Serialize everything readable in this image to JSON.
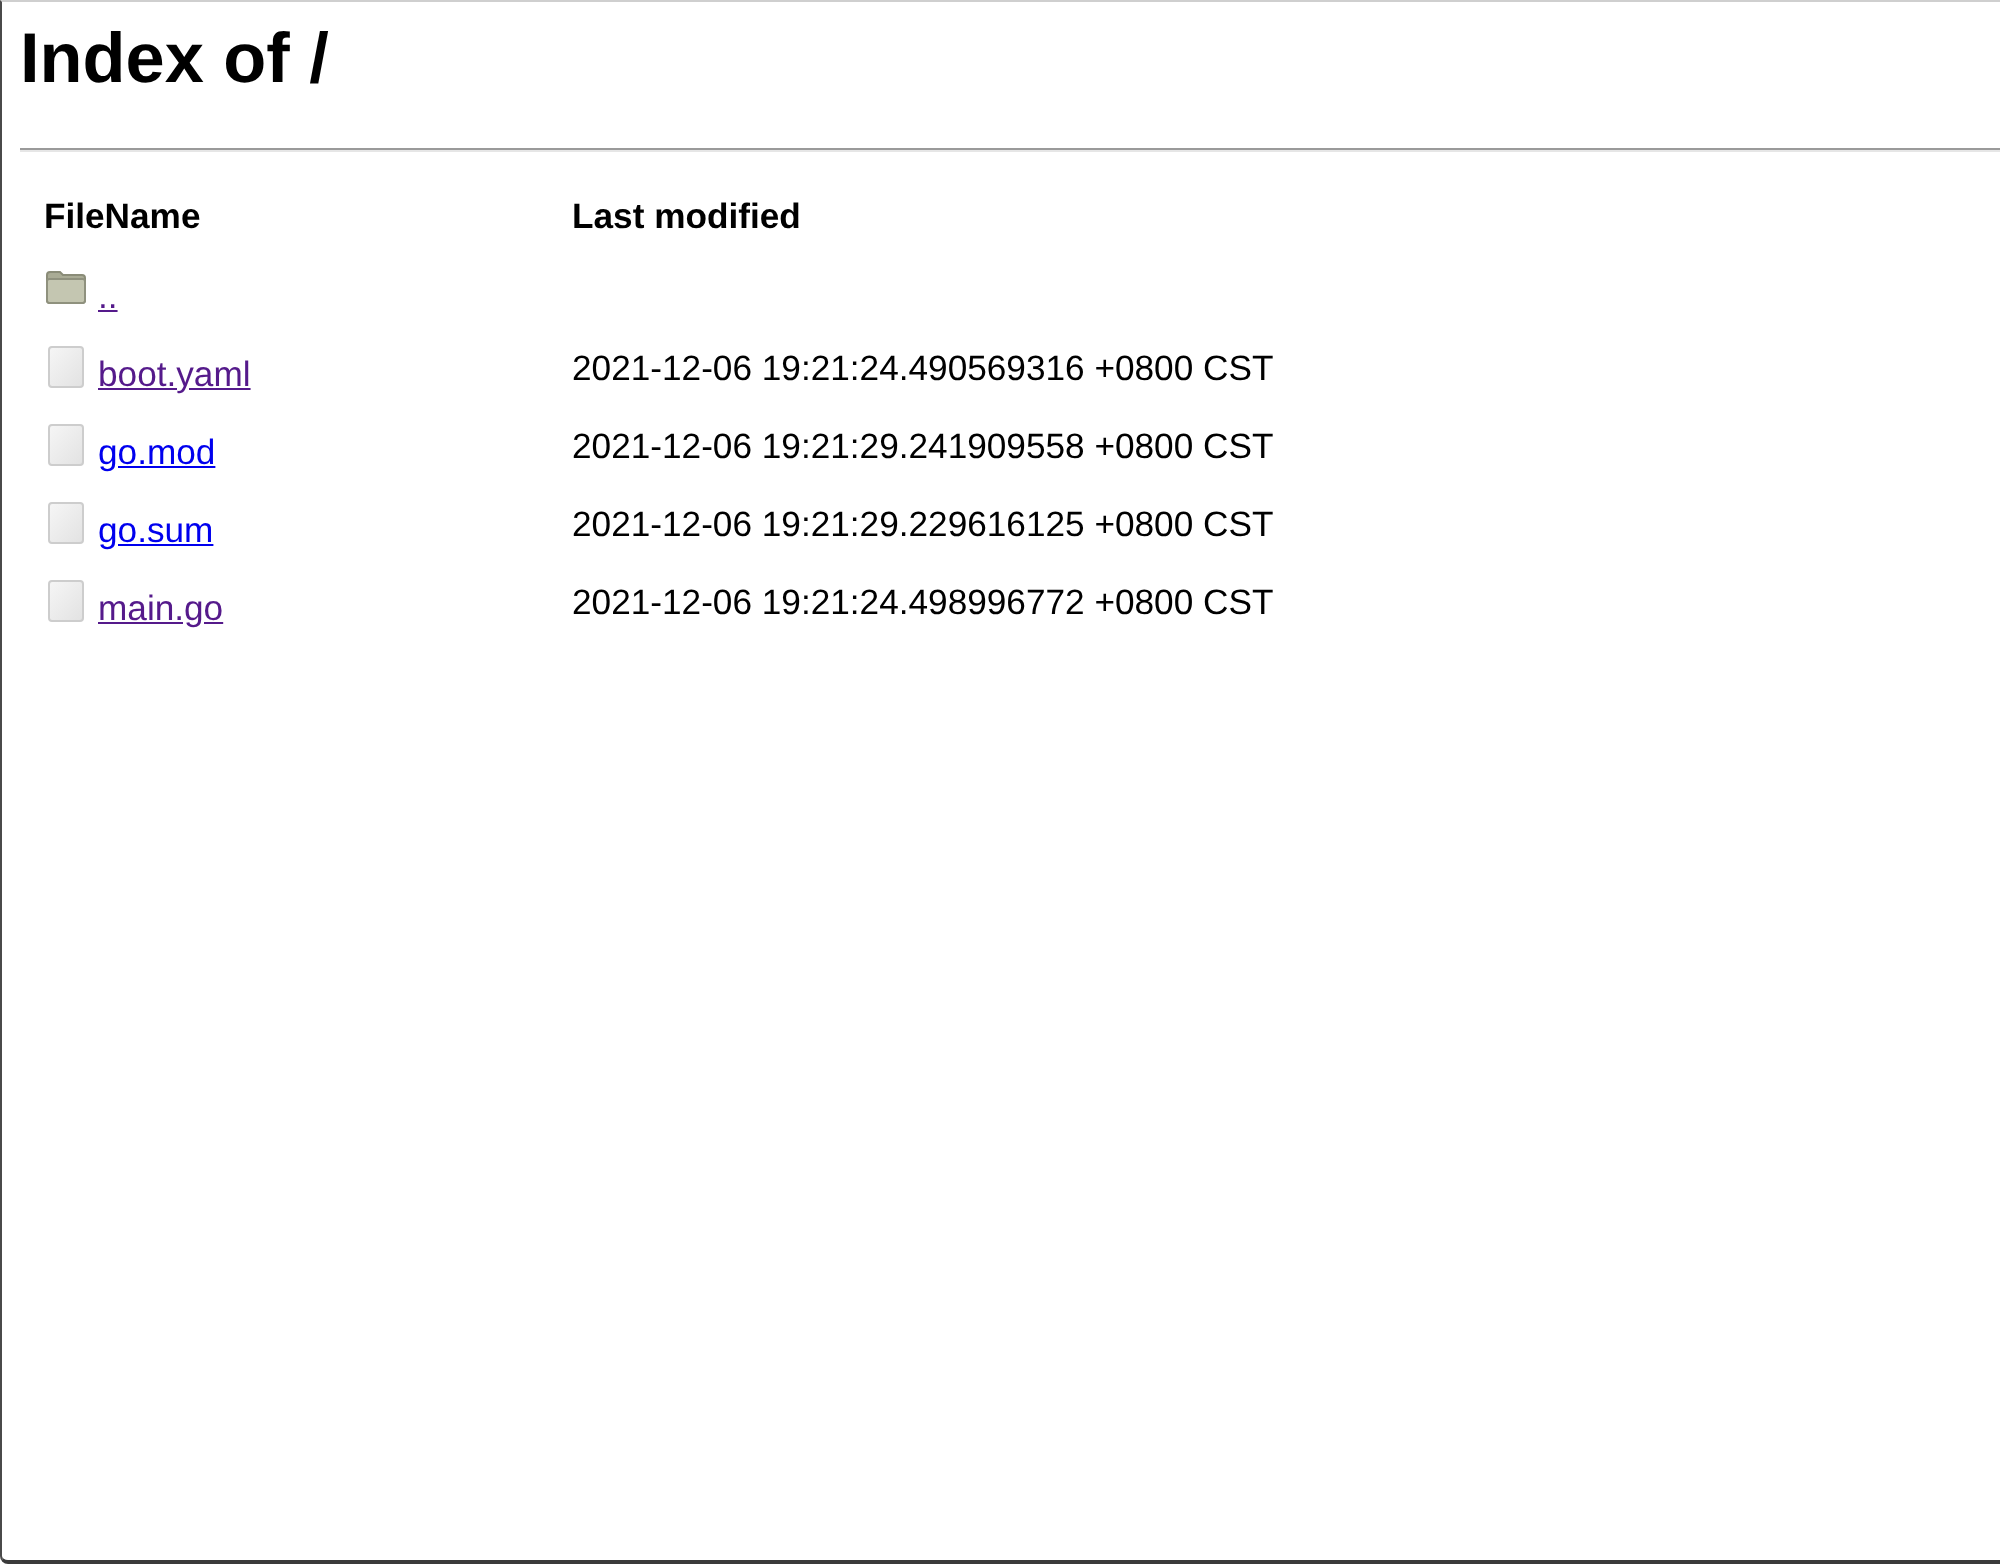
{
  "page": {
    "title": "Index of /"
  },
  "table": {
    "columns": [
      "FileName",
      "Last modified"
    ],
    "rows": [
      {
        "kind": "folder",
        "name": "..",
        "visited": true
      },
      {
        "kind": "file",
        "name": "boot.yaml",
        "visited": true,
        "modified": "2021-12-06 19:21:24.490569316 +0800 CST"
      },
      {
        "kind": "file",
        "name": "go.mod",
        "visited": false,
        "modified": "2021-12-06 19:21:29.241909558 +0800 CST"
      },
      {
        "kind": "file",
        "name": "go.sum",
        "visited": false,
        "modified": "2021-12-06 19:21:29.229616125 +0800 CST"
      },
      {
        "kind": "file",
        "name": "main.go",
        "visited": true,
        "modified": "2021-12-06 19:21:24.498996772 +0800 CST"
      }
    ]
  }
}
